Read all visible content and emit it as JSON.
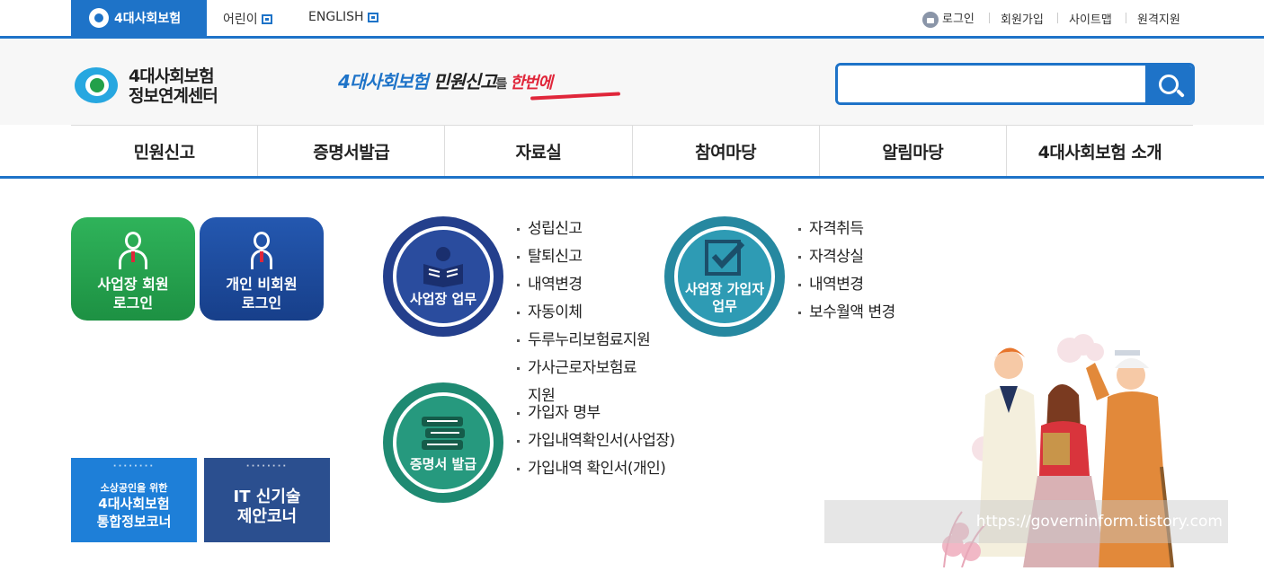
{
  "topbar": {
    "brand_tab": "4대사회보험",
    "links": [
      {
        "label": "어린이"
      },
      {
        "label": "ENGLISH"
      }
    ],
    "util": {
      "login": "로그인",
      "join": "회원가입",
      "sitemap": "사이트맵",
      "remote": "원격지원"
    }
  },
  "header": {
    "logo_line1": "4대사회보험",
    "logo_line2": "정보연계센터",
    "slogan": {
      "part1": "4대사회보험",
      "part2": " 민원신고",
      "part3": "를 ",
      "part4": "한번에"
    },
    "search": {
      "placeholder": "",
      "value": ""
    }
  },
  "gnb": [
    "민원신고",
    "증명서발급",
    "자료실",
    "참여마당",
    "알림마당",
    "4대사회보험 소개"
  ],
  "login_boxes": {
    "business": {
      "line1": "사업장 회원",
      "line2": "로그인"
    },
    "personal": {
      "line1": "개인 비회원",
      "line2": "로그인"
    }
  },
  "banners": {
    "smb": {
      "dots": "········",
      "small": "소상공인을 위한",
      "line1": "4대사회보험",
      "line2": "통합정보코너"
    },
    "it": {
      "dots": "········",
      "line1": "IT 신기술",
      "line2": "제안코너"
    }
  },
  "services": {
    "business": {
      "title": "사업장 업무",
      "items": [
        "성립신고",
        "탈퇴신고",
        "내역변경",
        "자동이체",
        "두루누리보험료지원",
        "가사근로자보험료",
        "지원"
      ]
    },
    "subscriber": {
      "title_line1": "사업장 가입자",
      "title_line2": "업무",
      "items": [
        "자격취득",
        "자격상실",
        "내역변경",
        "보수월액 변경"
      ]
    },
    "certificate": {
      "title": "증명서 발급",
      "items": [
        "가입자 명부",
        "가입내역확인서(사업장)",
        "가입내역 확인서(개인)"
      ]
    }
  },
  "watermark": "https://governinform.tistory.com",
  "colors": {
    "primary": "#1e73c8",
    "green": "#23a04a",
    "navy": "#1d4fa0",
    "accent_red": "#e0263a"
  }
}
